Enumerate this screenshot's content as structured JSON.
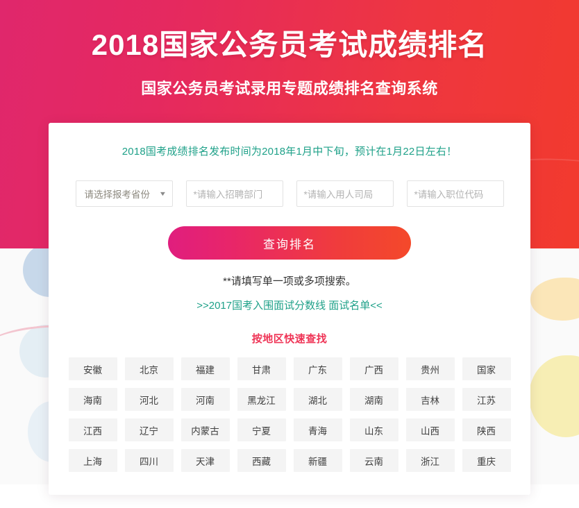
{
  "hero": {
    "title": "2018国家公务员考试成绩排名",
    "subtitle": "国家公务员考试录用专题成绩排名查询系统"
  },
  "card": {
    "notice": "2018国考成绩排名发布时间为2018年1月中下旬，预计在1月22日左右！",
    "form": {
      "province_select": {
        "selected": "请选择报考省份",
        "arrow": "chevron-down-icon"
      },
      "department_input": {
        "placeholder": "*请输入招聘部门",
        "value": ""
      },
      "bureau_input": {
        "placeholder": "*请输入用人司局",
        "value": ""
      },
      "job_code_input": {
        "placeholder": "*请输入职位代码",
        "value": ""
      }
    },
    "submit_label": "查询排名",
    "hint": "**请填写单一项或多项搜索。",
    "sub_link": ">>2017国考入围面试分数线 面试名单<<",
    "region_heading": "按地区快速查找",
    "regions": [
      "安徽",
      "北京",
      "福建",
      "甘肃",
      "广东",
      "广西",
      "贵州",
      "国家",
      "海南",
      "河北",
      "河南",
      "黑龙江",
      "湖北",
      "湖南",
      "吉林",
      "江苏",
      "江西",
      "辽宁",
      "内蒙古",
      "宁夏",
      "青海",
      "山东",
      "山西",
      "陕西",
      "上海",
      "四川",
      "天津",
      "西藏",
      "新疆",
      "云南",
      "浙江",
      "重庆"
    ]
  },
  "colors": {
    "hero_gradient_start": "#e0276c",
    "hero_gradient_end": "#f23a2d",
    "notice_text": "#1fa189",
    "link_text": "#1fa189",
    "region_heading": "#ef3456",
    "button_gradient_start": "#e01e7e",
    "button_gradient_end": "#f4492a",
    "tile_bg": "#f4f4f4",
    "page_bg": "#fafafa"
  }
}
